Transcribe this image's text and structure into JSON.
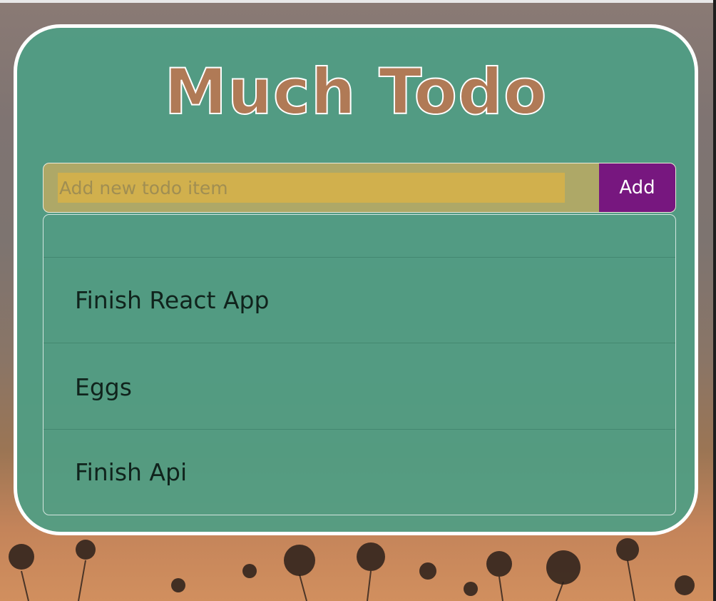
{
  "app": {
    "title": "Much Todo"
  },
  "new_todo": {
    "placeholder": "Add new todo item",
    "value": "",
    "add_label": "Add"
  },
  "todos": [
    {
      "label": ""
    },
    {
      "label": "Finish React App"
    },
    {
      "label": "Eggs"
    },
    {
      "label": "Finish Api"
    }
  ],
  "colors": {
    "card_background": "#4e9e84",
    "title_fill": "#b07a56",
    "input_background": "#d1b04d",
    "add_button": "#77177f",
    "text": "#10231c"
  }
}
